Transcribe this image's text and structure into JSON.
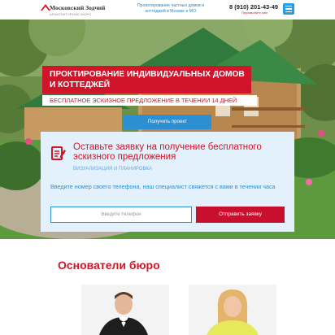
{
  "header": {
    "logo_title": "Московский Зодчий",
    "logo_sub": "АРХИТЕКТУРНОЕ БЮРО",
    "tagline": "Проектирование частных домов и коттеджей в Москве и МО",
    "phone": "8 (910) 201-43-49",
    "callback": "Перезвоните мне"
  },
  "hero": {
    "title": "Проктирование индивидуальных домов и коттеджей",
    "subtitle": "БЕСПЛАТНОЕ ЭСКИЗНОЕ ПРЕДЛОЖЕНИЕ В ТЕЧЕНИИ 14 ДНЕЙ",
    "button": "Получить проект"
  },
  "form": {
    "title": "Оставьте заявку на получение бесплатного эскизного предложения",
    "subtitle": "ВИЗУАЛИЗАЦИЯ И ПЛАНИРОВКА",
    "description": "Введите номер своего телефона, наш специалист свяжется с вами в течении часа",
    "phone_placeholder": "Введите телефон",
    "submit": "Отправить заявку"
  },
  "founders": {
    "title": "Основатели бюро"
  },
  "colors": {
    "brand_red": "#d0152a",
    "accent_blue": "#2b8fd2",
    "form_bg": "#e2f1fb"
  },
  "icons": [
    "house-roof-icon",
    "menu-icon",
    "document-edit-icon"
  ]
}
